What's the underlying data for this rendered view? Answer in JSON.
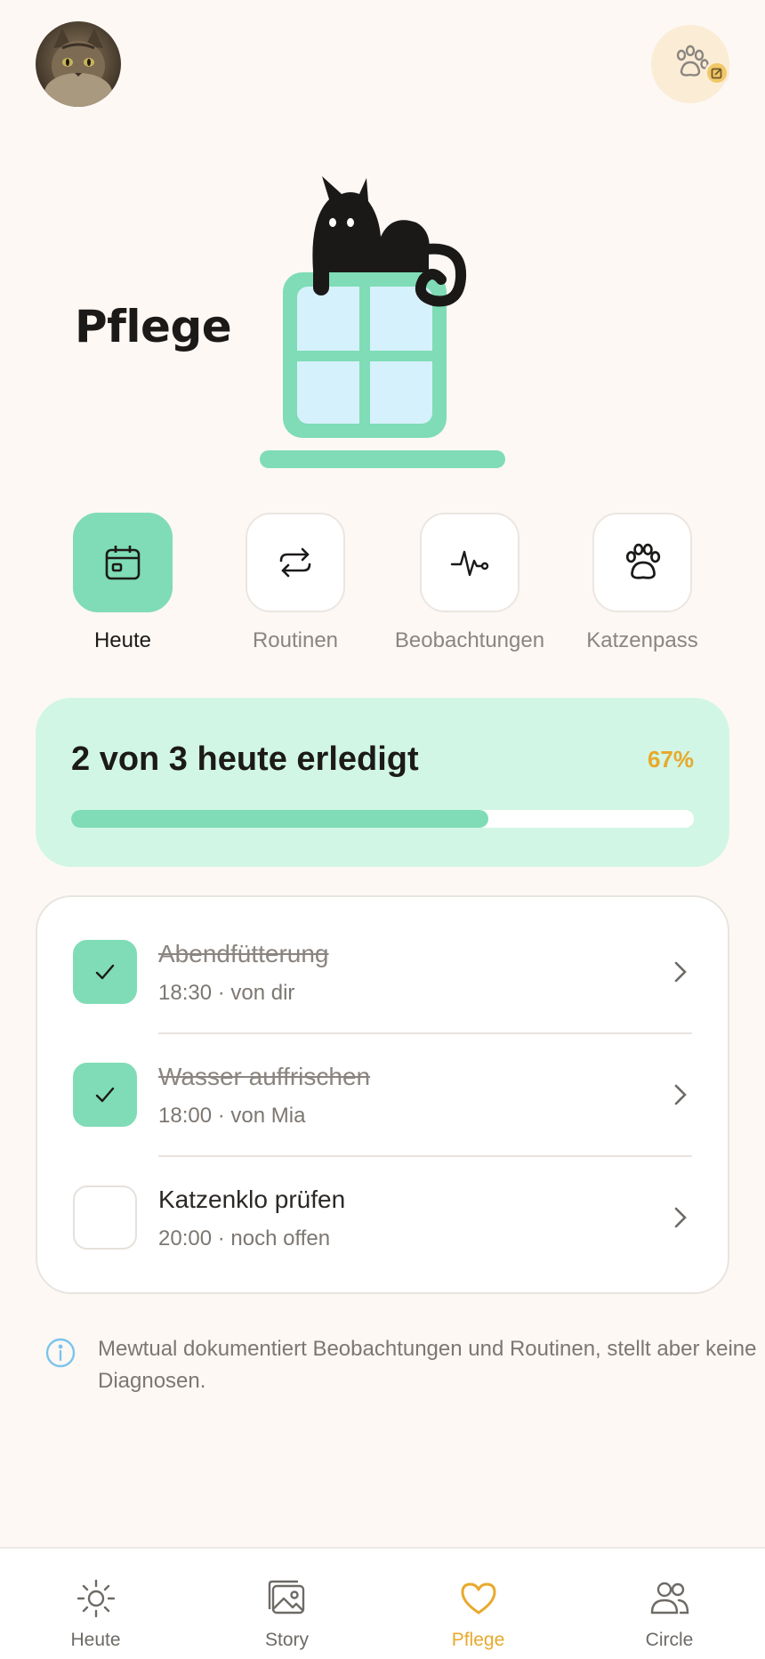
{
  "header": {
    "avatar_alt": "cat-photo",
    "profile_icon": "paw-icon",
    "edit_icon": "edit-icon"
  },
  "page": {
    "title": "Pflege"
  },
  "tabs": [
    {
      "label": "Heute",
      "icon": "calendar-icon",
      "active": true
    },
    {
      "label": "Routinen",
      "icon": "repeat-icon",
      "active": false
    },
    {
      "label": "Beobachtungen",
      "icon": "pulse-icon",
      "active": false
    },
    {
      "label": "Katzenpass",
      "icon": "paw-icon",
      "active": false
    }
  ],
  "progress": {
    "title": "2 von 3 heute erledigt",
    "percent_label": "67%",
    "fraction": 0.67
  },
  "tasks": [
    {
      "title": "Abendfütterung",
      "subtitle": "18:30 · von dir",
      "done": true
    },
    {
      "title": "Wasser auffrischen",
      "subtitle": "18:00 · von Mia",
      "done": true
    },
    {
      "title": "Katzenklo prüfen",
      "subtitle": "20:00 · noch offen",
      "done": false
    }
  ],
  "info": {
    "text": "Mewtual dokumentiert Beobachtungen und Routinen, stellt aber keine Diagnosen."
  },
  "bottom_nav": [
    {
      "label": "Heute",
      "icon": "sun-icon",
      "active": false
    },
    {
      "label": "Story",
      "icon": "gallery-icon",
      "active": false
    },
    {
      "label": "Pflege",
      "icon": "heart-icon",
      "active": true
    },
    {
      "label": "Circle",
      "icon": "people-icon",
      "active": false
    }
  ],
  "colors": {
    "accent_green": "#7fdcb6",
    "accent_orange": "#e8a92c",
    "background": "#fdf8f4"
  }
}
